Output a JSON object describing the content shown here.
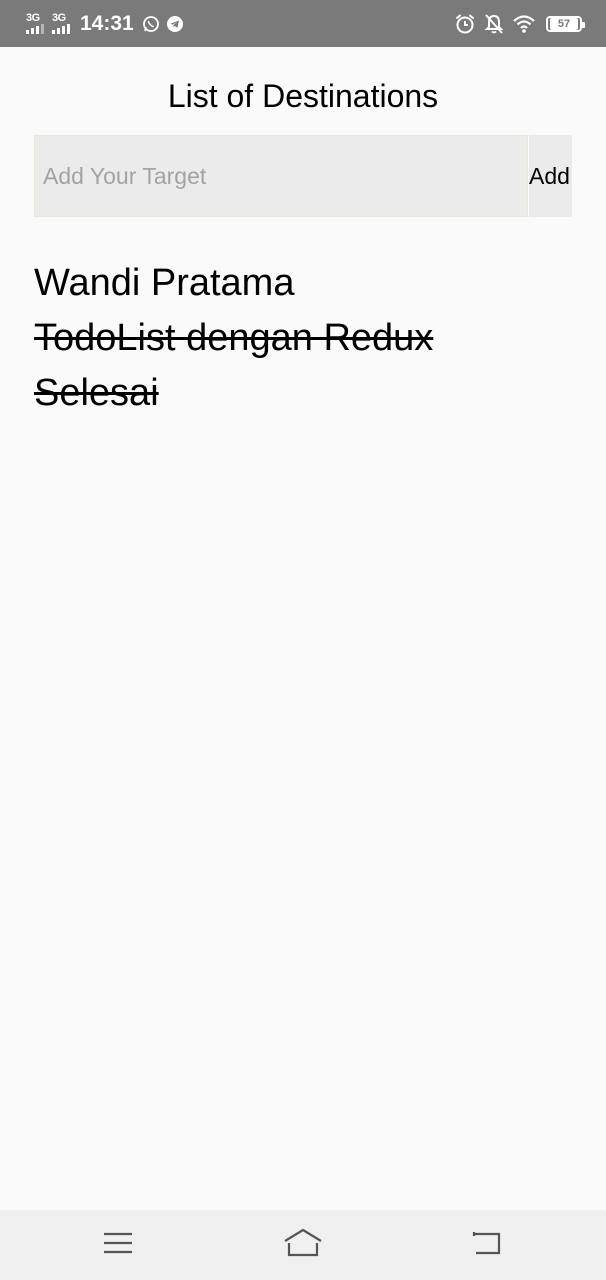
{
  "status_bar": {
    "network_1": "3G",
    "network_2": "3G",
    "time": "14:31",
    "battery": "57",
    "icons": [
      "whatsapp-icon",
      "telegram-icon",
      "alarm-icon",
      "notifications-off-icon",
      "wifi-icon",
      "battery-icon"
    ]
  },
  "page": {
    "title": "List of Destinations"
  },
  "form": {
    "input_value": "",
    "input_placeholder": "Add Your Target",
    "add_label": "Add"
  },
  "todos": [
    {
      "text": "Wandi Pratama",
      "completed": false
    },
    {
      "text": "TodoList dengan Redux",
      "completed": true
    },
    {
      "text": "Selesai",
      "completed": true
    }
  ],
  "nav_bar": {
    "icons": [
      "menu-icon",
      "home-icon",
      "back-icon"
    ]
  },
  "colors": {
    "status_bar_bg": "#7a7a7a",
    "background": "#fafafa",
    "input_bg": "#ebebeb",
    "placeholder": "#a3a3a3",
    "nav_bar_bg": "#f0f0f0"
  }
}
